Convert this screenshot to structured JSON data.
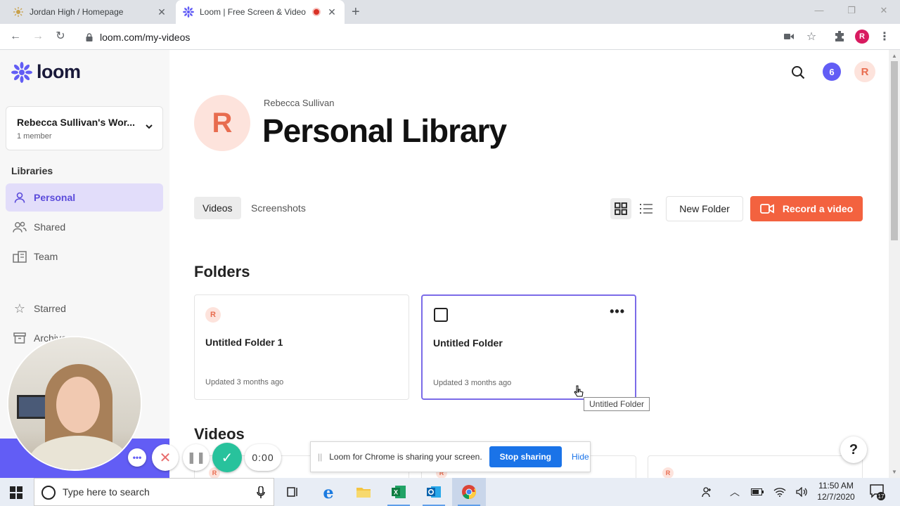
{
  "browser": {
    "tabs": [
      {
        "title": "Jordan High / Homepage",
        "active": false
      },
      {
        "title": "Loom | Free Screen & Video",
        "active": true,
        "recording": true
      }
    ],
    "url": "loom.com/my-videos",
    "profile_initial": "R"
  },
  "sidebar": {
    "logo_text": "loom",
    "workspace": {
      "name": "Rebecca Sullivan's Wor...",
      "members": "1 member"
    },
    "libraries_label": "Libraries",
    "nav": [
      {
        "label": "Personal",
        "icon": "person-icon",
        "active": true
      },
      {
        "label": "Shared",
        "icon": "people-icon",
        "active": false
      },
      {
        "label": "Team",
        "icon": "building-icon",
        "active": false
      },
      {
        "label": "Starred",
        "icon": "star-icon",
        "active": false
      },
      {
        "label": "Archive",
        "icon": "archive-icon",
        "active": false
      }
    ]
  },
  "header": {
    "notification_count": "6",
    "user_initial": "R"
  },
  "library": {
    "avatar_initial": "R",
    "owner": "Rebecca Sullivan",
    "title": "Personal Library",
    "tabs": [
      "Videos",
      "Screenshots"
    ],
    "new_folder_label": "New Folder",
    "record_label": "Record a video",
    "folders_heading": "Folders",
    "videos_heading": "Videos",
    "folders": [
      {
        "name": "Untitled Folder 1",
        "updated": "Updated 3 months ago",
        "avatar": "R",
        "selected": false
      },
      {
        "name": "Untitled Folder",
        "updated": "Updated 3 months ago",
        "avatar": "",
        "selected": true
      }
    ],
    "tooltip": "Untitled Folder",
    "video_avatar": "R"
  },
  "recording": {
    "timer": "0:00"
  },
  "share_bar": {
    "message": "Loom for Chrome is sharing your screen.",
    "stop_label": "Stop sharing",
    "hide_label": "Hide"
  },
  "taskbar": {
    "search_placeholder": "Type here to search",
    "time": "11:50 AM",
    "date": "12/7/2020",
    "notifications": "17"
  },
  "colors": {
    "brand": "#625df5",
    "record": "#f3623f",
    "active_nav_bg": "#e2ddfa",
    "selected_border": "#7b6be8"
  }
}
